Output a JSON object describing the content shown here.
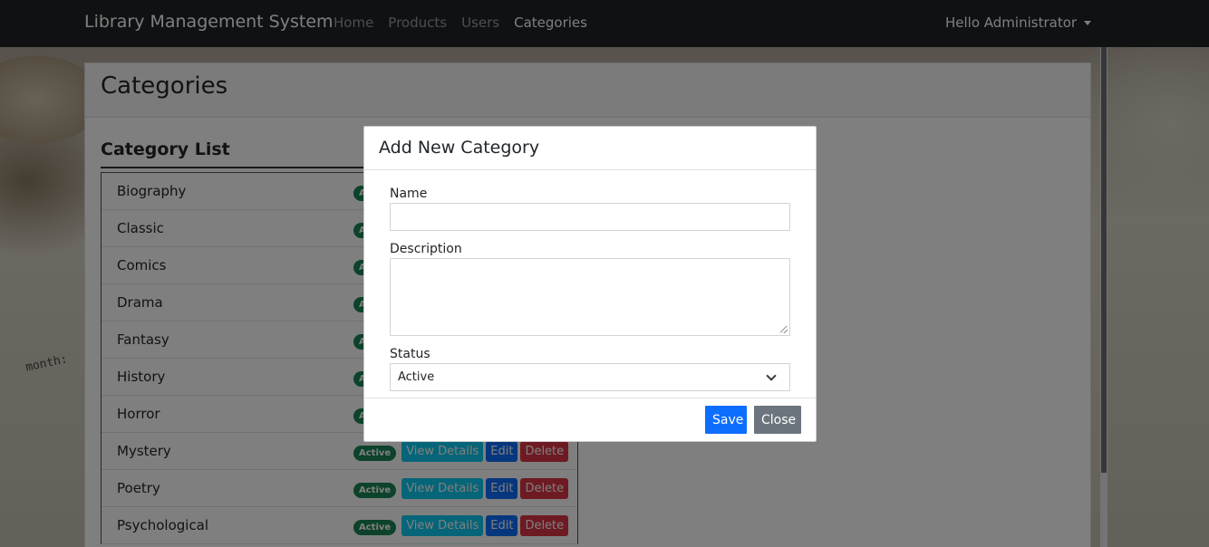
{
  "navbar": {
    "brand": "Library Management System",
    "links": [
      "Home",
      "Products",
      "Users",
      "Categories"
    ],
    "active": "Categories",
    "user_menu": "Hello Administrator"
  },
  "background": {
    "text": "month:"
  },
  "page": {
    "title": "Categories",
    "section_title": "Category List"
  },
  "categories": [
    {
      "name": "Biography",
      "status": "Active"
    },
    {
      "name": "Classic",
      "status": "Active"
    },
    {
      "name": "Comics",
      "status": "Active"
    },
    {
      "name": "Drama",
      "status": "Active"
    },
    {
      "name": "Fantasy",
      "status": "Active"
    },
    {
      "name": "History",
      "status": "Active"
    },
    {
      "name": "Horror",
      "status": "Active"
    },
    {
      "name": "Mystery",
      "status": "Active"
    },
    {
      "name": "Poetry",
      "status": "Active"
    },
    {
      "name": "Psychological",
      "status": "Active"
    }
  ],
  "row_actions": {
    "view": "View Details",
    "edit": "Edit",
    "delete": "Delete"
  },
  "modal": {
    "title": "Add New Category",
    "name_label": "Name",
    "name_value": "",
    "description_label": "Description",
    "description_value": "",
    "status_label": "Status",
    "status_value": "Active",
    "save_label": "Save",
    "close_label": "Close"
  },
  "colors": {
    "navbar": "#1f2326",
    "primary": "#0d6efd",
    "info": "#0dcaf0",
    "danger": "#dc3545",
    "success": "#198754",
    "secondary": "#6c757d"
  }
}
